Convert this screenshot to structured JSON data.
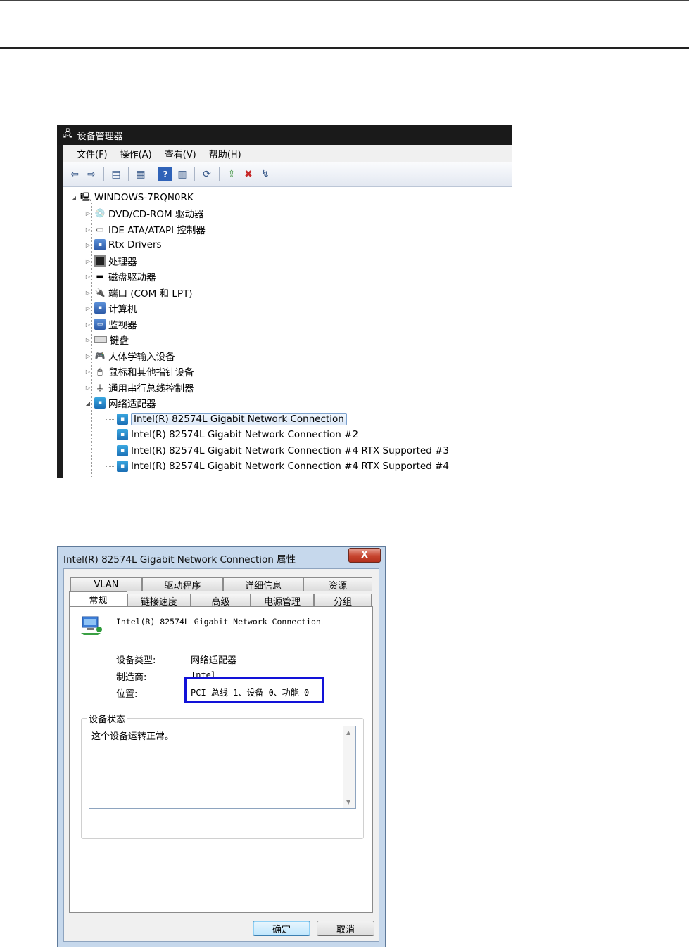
{
  "device_manager": {
    "title": "设备管理器",
    "menu": [
      "文件(F)",
      "操作(A)",
      "查看(V)",
      "帮助(H)"
    ],
    "toolbar_icons": [
      "back-icon",
      "forward-icon",
      "show-hide-tree-icon",
      "properties-icon",
      "help-icon",
      "show-action-pane-icon",
      "scan-hardware-icon",
      "update-driver-icon",
      "disable-device-icon",
      "uninstall-device-icon"
    ],
    "root": "WINDOWS-7RQN0RK",
    "categories": [
      "DVD/CD-ROM 驱动器",
      "IDE ATA/ATAPI 控制器",
      "Rtx Drivers",
      "处理器",
      "磁盘驱动器",
      "端口 (COM 和 LPT)",
      "计算机",
      "监视器",
      "键盘",
      "人体学输入设备",
      "鼠标和其他指针设备",
      "通用串行总线控制器",
      "网络适配器"
    ],
    "network_adapters": [
      "Intel(R) 82574L Gigabit Network Connection",
      "Intel(R) 82574L Gigabit Network Connection #2",
      "Intel(R) 82574L Gigabit Network Connection #4 RTX Supported #3",
      "Intel(R) 82574L Gigabit Network Connection #4 RTX Supported #4"
    ]
  },
  "properties_dialog": {
    "title": "Intel(R) 82574L Gigabit Network Connection 属性",
    "close_label": "X",
    "tabs_back": [
      "VLAN",
      "驱动程序",
      "详细信息",
      "资源"
    ],
    "tabs_front": [
      "常规",
      "链接速度",
      "高级",
      "电源管理",
      "分组"
    ],
    "device_name": "Intel(R) 82574L Gigabit Network Connection",
    "device_type_label": "设备类型:",
    "device_type_value": "网络适配器",
    "manufacturer_label": "制造商:",
    "manufacturer_value": "Intel",
    "location_label": "位置:",
    "location_value": "PCI 总线 1、设备 0、功能 0",
    "status_group_label": "设备状态",
    "status_text": "这个设备运转正常。",
    "ok_label": "确定",
    "cancel_label": "取消"
  },
  "colors": {
    "highlight_border": "#1212d8",
    "selection": "#dbe8f8"
  }
}
